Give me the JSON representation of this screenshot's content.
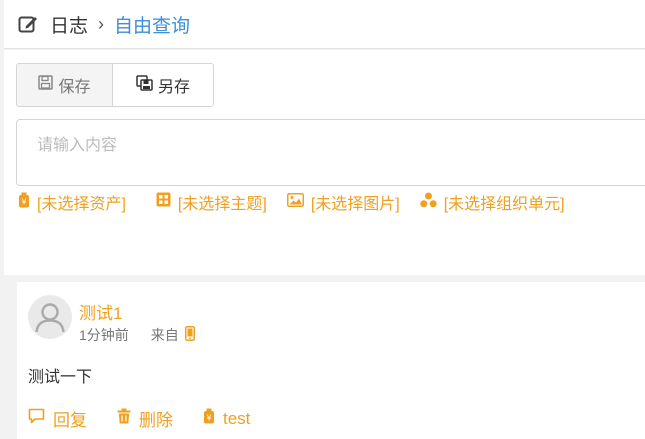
{
  "header": {
    "edit_icon": "edit-icon",
    "crumb_root": "日志",
    "separator": "›",
    "crumb_current": "自由查询"
  },
  "toolbar": {
    "save_label": "保存",
    "save_icon": "floppy-disk-icon",
    "saveas_label": "另存",
    "saveas_icon": "save-as-icon"
  },
  "editor": {
    "placeholder": "请输入内容",
    "value": ""
  },
  "selectors": [
    {
      "icon": "asset-tag-icon",
      "label": "[未选择资产]"
    },
    {
      "icon": "grid-icon",
      "label": "[未选择主题]"
    },
    {
      "icon": "image-icon",
      "label": "[未选择图片]"
    },
    {
      "icon": "org-unit-icon",
      "label": "[未选择组织单元]"
    }
  ],
  "post": {
    "author": "测试1",
    "time": "1分钟前",
    "from_label": "来自",
    "source_icon": "mobile-phone-icon",
    "content": "测试一下",
    "actions": [
      {
        "icon": "comment-icon",
        "label": "回复"
      },
      {
        "icon": "trash-icon",
        "label": "删除"
      },
      {
        "icon": "asset-tag-icon",
        "label": "test"
      }
    ]
  },
  "colors": {
    "accent": "#f0a020",
    "link": "#3d8fd6",
    "background": "#f2f2f2"
  }
}
